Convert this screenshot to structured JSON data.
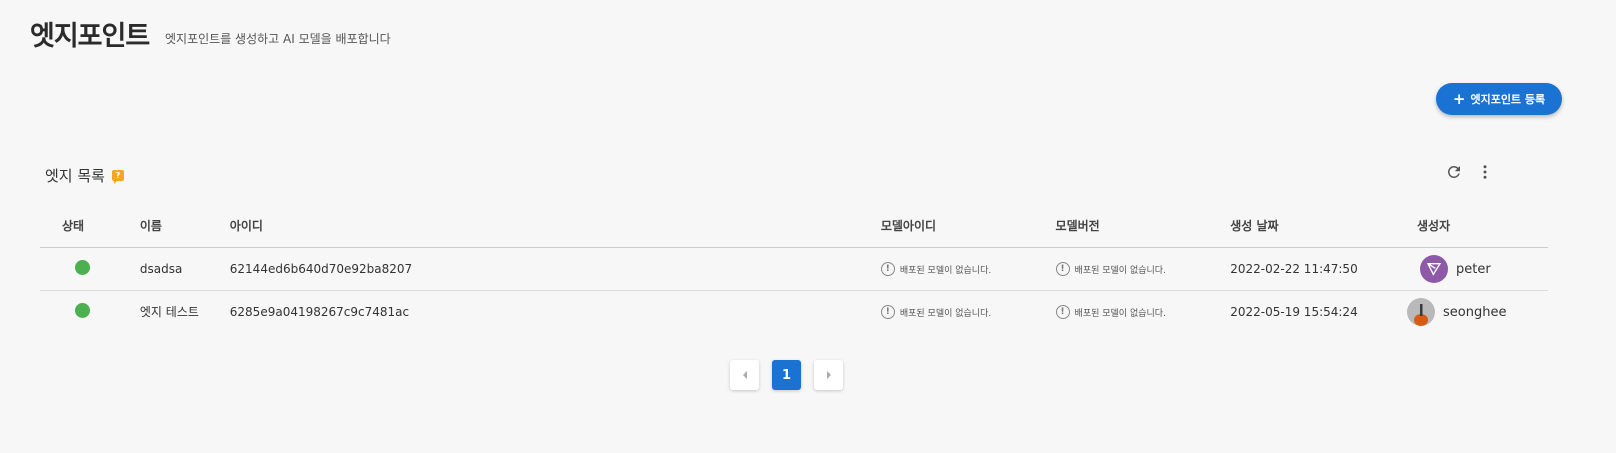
{
  "header": {
    "title": "엣지포인트",
    "subtitle": "엣지포인트를 생성하고 AI 모델을 배포합니다"
  },
  "actions": {
    "add_label": "엣지포인트 등록"
  },
  "section": {
    "title": "엣지 목록",
    "help_icon": "help-badge-icon",
    "refresh_icon": "refresh-icon",
    "more_icon": "more-vert-icon"
  },
  "table": {
    "columns": [
      "상태",
      "이름",
      "아이디",
      "모델아이디",
      "모델버전",
      "생성 날짜",
      "생성자"
    ],
    "rows": [
      {
        "status": "online",
        "name": "dsadsa",
        "id": "62144ed6b640d70e92ba8207",
        "model_id": "배포된 모델이 없습니다.",
        "model_version": "배포된 모델이 없습니다.",
        "created": "2022-02-22 11:47:50",
        "creator": "peter"
      },
      {
        "status": "online",
        "name": "엣지 테스트",
        "id": "6285e9a04198267c9c7481ac",
        "model_id": "배포된 모델이 없습니다.",
        "model_version": "배포된 모델이 없습니다.",
        "created": "2022-05-19 15:54:24",
        "creator": "seonghee"
      }
    ]
  },
  "pagination": {
    "current": "1"
  },
  "colors": {
    "accent": "#1a73d3",
    "status_online": "#4caf50",
    "help_badge": "#f5a623"
  }
}
